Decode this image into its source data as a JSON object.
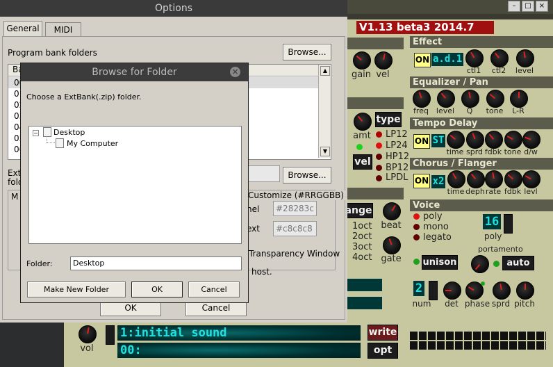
{
  "synth": {
    "version": "V1.13 beta3 2014.7",
    "title_buttons": [
      "–",
      "□",
      "×"
    ],
    "left_knobs": {
      "gain": "gain",
      "vel": "vel",
      "amt": "amt"
    },
    "filter_type_button": "type",
    "filter_types": [
      "LP12",
      "LP24",
      "HP12",
      "BP12",
      "LPDL"
    ],
    "vel_button": "vel",
    "range_button": "ange",
    "octaves": [
      "1oct",
      "2oct",
      "3oct",
      "4oct"
    ],
    "beat_label": "beat",
    "gate_label": "gate",
    "effect": {
      "header": "Effect",
      "on": "ON",
      "name": "a.d.1",
      "knobs": [
        "ctl1",
        "ctl2",
        "level"
      ]
    },
    "eq": {
      "header": "Equalizer / Pan",
      "knobs": [
        "freq",
        "level",
        "Q",
        "tone",
        "L-R"
      ]
    },
    "delay": {
      "header": "Tempo Delay",
      "on": "ON",
      "mode": "ST",
      "knobs": [
        "time",
        "sprd",
        "fdbk",
        "tone",
        "d/w"
      ]
    },
    "chorus": {
      "header": "Chorus / Flanger",
      "on": "ON",
      "mode": "x2",
      "knobs": [
        "time",
        "deph",
        "rate",
        "fdbk",
        "levl"
      ]
    },
    "voice": {
      "header": "Voice",
      "modes": [
        "poly",
        "mono",
        "legato"
      ],
      "poly_value": "16",
      "poly_label": "poly",
      "portamento_label": "portamento",
      "unison_button": "unison",
      "auto_button": "auto",
      "num_value": "2",
      "bottom_knobs": [
        "num",
        "det",
        "phase",
        "sprd",
        "pitch"
      ]
    },
    "vol_label": "vol",
    "program_name": "1:initial sound",
    "program_sub": "00:",
    "write_button": "write",
    "opt_button": "opt"
  },
  "options": {
    "title": "Options",
    "tabs": [
      "General",
      "MIDI"
    ],
    "program_bank_label": "Program bank folders",
    "browse1": "Browse...",
    "browse2": "Browse...",
    "list_header_partial": "Ba",
    "list_rows_partial": [
      "00",
      "01",
      "02",
      "03",
      "04",
      "05",
      "06",
      "07"
    ],
    "ext_partial1": "Ext",
    "ext_partial2": "fold",
    "m_partial": "M",
    "customize_label": "Customize (#RRGGBB)",
    "panel_label": "nel",
    "panel_value": "#28283c",
    "text_label": "ext",
    "text_value": "#c8c8c8",
    "transparency_label": "Transparency Window",
    "host_label": "host.",
    "ok": "OK",
    "cancel": "Cancel"
  },
  "browse": {
    "title": "Browse for Folder",
    "close_glyph": "×",
    "instruction": "Choose a ExtBank(.zip) folder.",
    "tree": [
      "Desktop",
      "My Computer"
    ],
    "folder_label": "Folder:",
    "folder_value": "Desktop",
    "make_new_folder": "Make New Folder",
    "ok": "OK",
    "cancel": "Cancel"
  },
  "colors": {
    "synth_bg": "#c8c8a0",
    "lcd_bg": "#003838",
    "lcd_text": "#20e0e0",
    "version_bg": "#a01010"
  }
}
